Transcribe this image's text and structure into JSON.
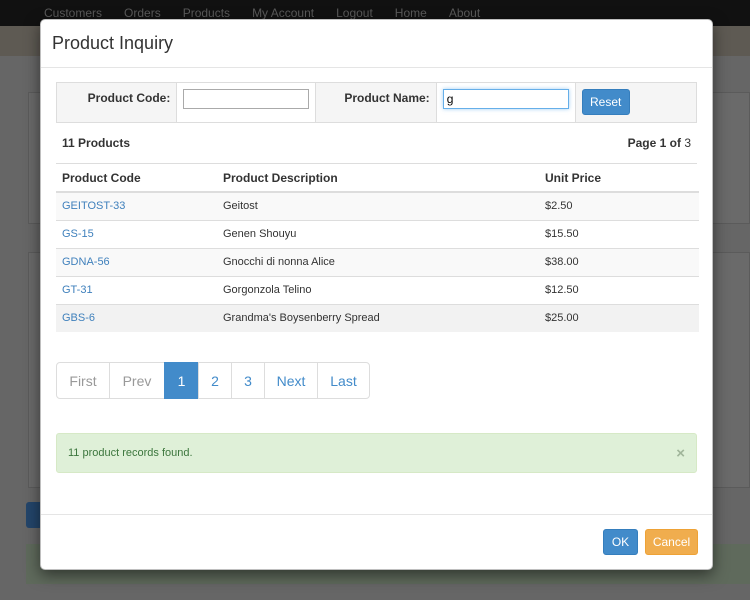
{
  "background": {
    "nav": [
      "Customers",
      "Orders",
      "Products",
      "My Account",
      "Logout",
      "Home",
      "About"
    ]
  },
  "modal": {
    "title": "Product Inquiry",
    "search": {
      "code_label": "Product Code:",
      "code_value": "",
      "name_label": "Product Name:",
      "name_value": "g",
      "reset_label": "Reset"
    },
    "summary": {
      "count_text": "11 Products",
      "page_prefix": "Page",
      "page_current": "1",
      "page_of": "of",
      "page_total": "3"
    },
    "table": {
      "headers": [
        "Product Code",
        "Product Description",
        "Unit Price"
      ],
      "rows": [
        {
          "code": "GEITOST-33",
          "description": "Geitost",
          "price": "$2.50"
        },
        {
          "code": "GS-15",
          "description": "Genen Shouyu",
          "price": "$15.50"
        },
        {
          "code": "GDNA-56",
          "description": "Gnocchi di nonna Alice",
          "price": "$38.00"
        },
        {
          "code": "GT-31",
          "description": "Gorgonzola Telino",
          "price": "$12.50"
        },
        {
          "code": "GBS-6",
          "description": "Grandma's Boysenberry Spread",
          "price": "$25.00"
        }
      ]
    },
    "pagination": {
      "first": "First",
      "prev": "Prev",
      "pages": [
        "1",
        "2",
        "3"
      ],
      "next": "Next",
      "last": "Last"
    },
    "alert": {
      "message": "11 product records found.",
      "close": "×"
    },
    "footer": {
      "ok_label": "OK",
      "cancel_label": "Cancel"
    }
  },
  "colors": {
    "primary": "#428bca",
    "warning": "#f0ad4e",
    "success_bg": "#dff0d8",
    "link": "#3f80bc"
  }
}
